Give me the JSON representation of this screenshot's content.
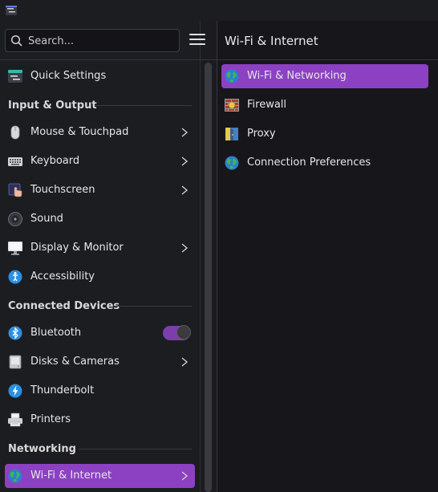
{
  "search": {
    "placeholder": "Search..."
  },
  "right_panel": {
    "title": "Wi-Fi & Internet",
    "items": [
      {
        "label": "Wi-Fi & Networking",
        "icon": "globe-icon",
        "selected": true
      },
      {
        "label": "Firewall",
        "icon": "firewall-icon",
        "selected": false
      },
      {
        "label": "Proxy",
        "icon": "proxy-icon",
        "selected": false
      },
      {
        "label": "Connection Preferences",
        "icon": "globe-icon",
        "selected": false
      }
    ]
  },
  "sidebar": {
    "quick_settings": {
      "label": "Quick Settings",
      "icon": "quick-settings-icon"
    },
    "sections": [
      {
        "title": "Input & Output",
        "items": [
          {
            "label": "Mouse & Touchpad",
            "icon": "mouse-icon",
            "chevron": true
          },
          {
            "label": "Keyboard",
            "icon": "keyboard-icon",
            "chevron": true
          },
          {
            "label": "Touchscreen",
            "icon": "touchscreen-icon",
            "chevron": true
          },
          {
            "label": "Sound",
            "icon": "sound-icon",
            "chevron": false
          },
          {
            "label": "Display & Monitor",
            "icon": "monitor-icon",
            "chevron": true
          },
          {
            "label": "Accessibility",
            "icon": "accessibility-icon",
            "chevron": false
          }
        ]
      },
      {
        "title": "Connected Devices",
        "items": [
          {
            "label": "Bluetooth",
            "icon": "bluetooth-icon",
            "toggle": true,
            "toggle_on": true
          },
          {
            "label": "Disks & Cameras",
            "icon": "disk-icon",
            "chevron": true
          },
          {
            "label": "Thunderbolt",
            "icon": "thunderbolt-icon",
            "chevron": false
          },
          {
            "label": "Printers",
            "icon": "printer-icon",
            "chevron": false
          }
        ]
      },
      {
        "title": "Networking",
        "items": [
          {
            "label": "Wi-Fi & Internet",
            "icon": "globe-icon",
            "chevron": true,
            "selected": true
          }
        ]
      }
    ]
  },
  "colors": {
    "accent": "#8c41c3",
    "background": "#1c1d21",
    "panel": "#17171b"
  }
}
